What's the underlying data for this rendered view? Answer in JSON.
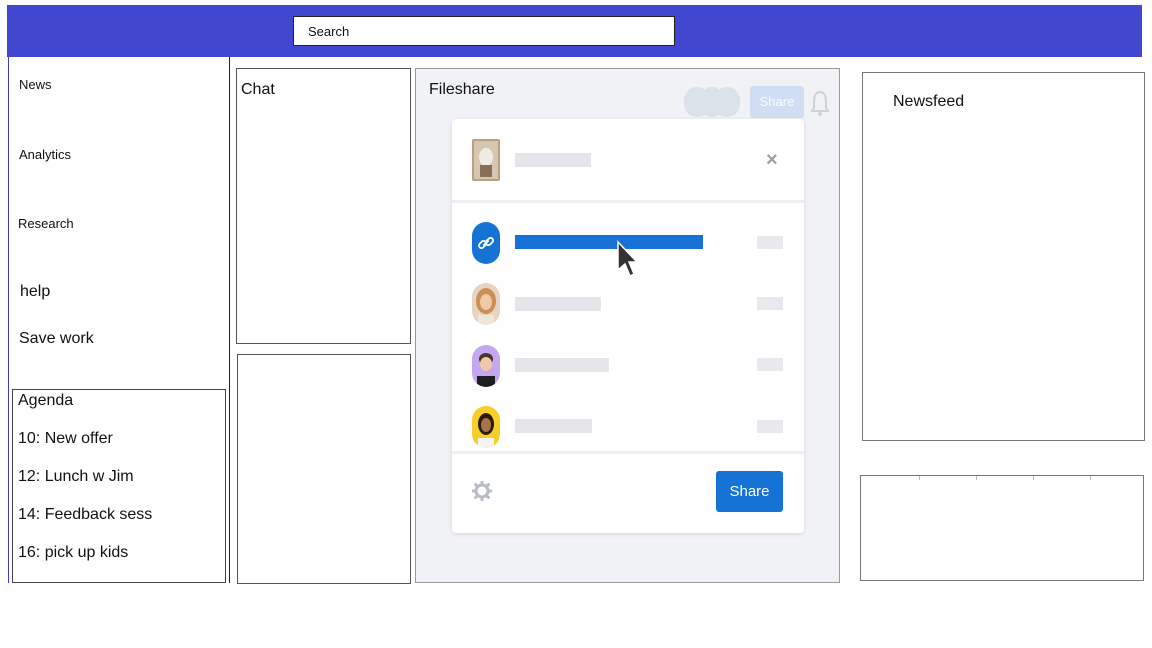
{
  "search": {
    "placeholder": "Search"
  },
  "sidebar": {
    "items": [
      {
        "label": "News"
      },
      {
        "label": "Analytics"
      },
      {
        "label": "Research"
      },
      {
        "label": "help"
      },
      {
        "label": "Save work"
      }
    ]
  },
  "agenda": {
    "title": "Agenda",
    "items": [
      "10: New offer",
      "12: Lunch w Jim",
      "14: Feedback sess",
      "16: pick up kids"
    ]
  },
  "panels": {
    "chat": "Chat",
    "fileshare": "Fileshare",
    "newsfeed": "Newsfeed"
  },
  "share_dialog": {
    "background_share_label": "Share",
    "close_symbol": "×",
    "share_button": "Share",
    "accent_color": "#1673d6"
  },
  "colors": {
    "topbar": "#4148cf"
  }
}
